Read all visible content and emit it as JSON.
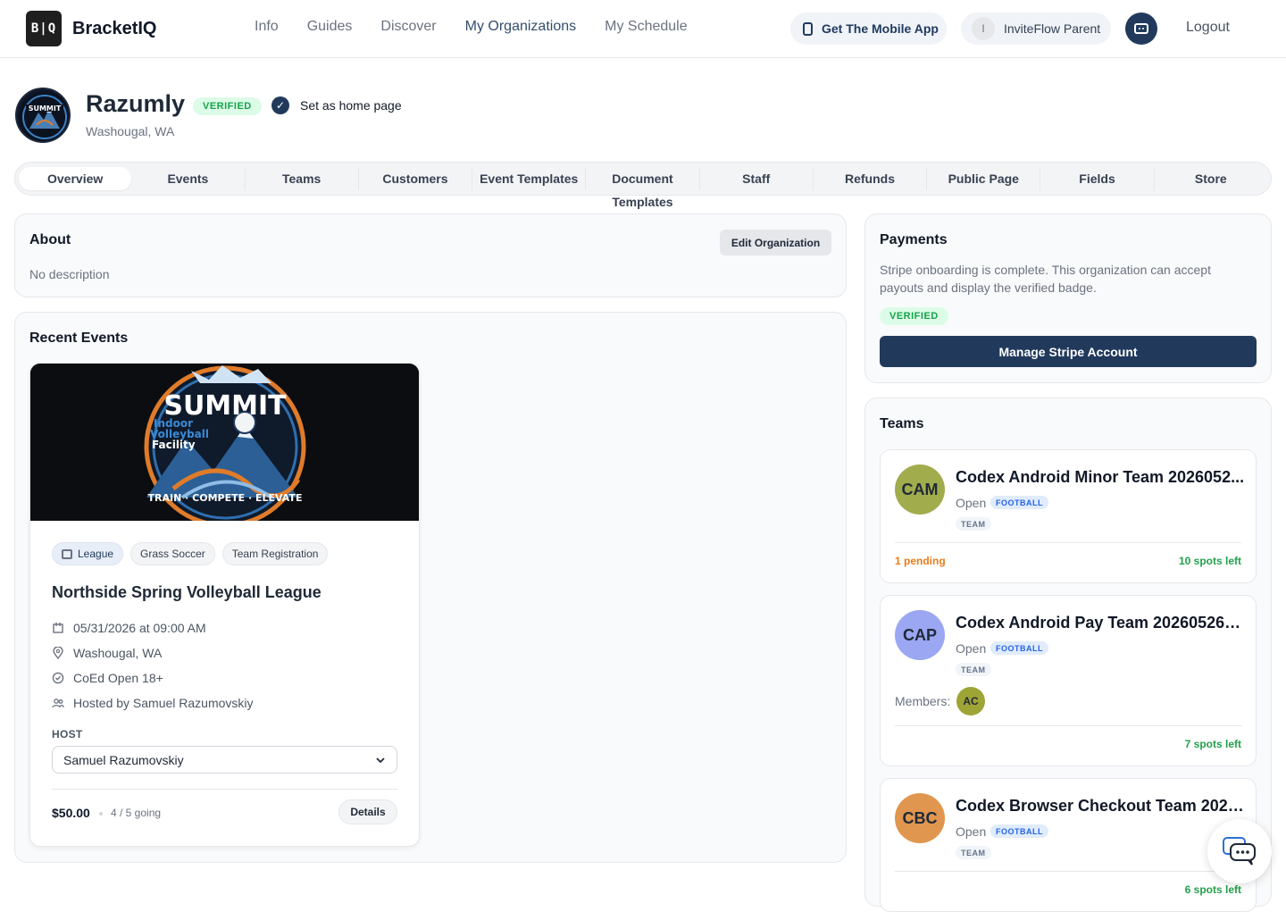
{
  "app": {
    "logo_text": "B|Q",
    "name": "BracketIQ"
  },
  "nav": {
    "links": [
      "Info",
      "Guides",
      "Discover",
      "My Organizations",
      "My Schedule"
    ],
    "mobile_app": "Get The Mobile App",
    "user_initial": "I",
    "user_name": "InviteFlow Parent",
    "logout": "Logout"
  },
  "org": {
    "name": "Razumly",
    "verified": "VERIFIED",
    "home_page_label": "Set as home page",
    "location": "Washougal, WA"
  },
  "tabs": [
    "Overview",
    "Events",
    "Teams",
    "Customers",
    "Event Templates",
    "Document Templates",
    "Staff",
    "Refunds",
    "Public Page",
    "Fields",
    "Store"
  ],
  "about": {
    "title": "About",
    "edit_button": "Edit Organization",
    "description": "No description"
  },
  "recent_events": {
    "title": "Recent Events",
    "event": {
      "hero": {
        "title": "SUMMIT",
        "sub1": "Indoor",
        "sub2": "Volleyball",
        "sub3": "Facility",
        "tagline": "TRAIN · COMPETE · ELEVATE"
      },
      "chips": [
        "League",
        "Grass Soccer",
        "Team Registration"
      ],
      "title": "Northside Spring Volleyball League",
      "datetime": "05/31/2026 at 09:00 AM",
      "location": "Washougal, WA",
      "division": "CoEd Open 18+",
      "hosted_by": "Hosted by Samuel Razumovskiy",
      "host_label": "HOST",
      "host_value": "Samuel Razumovskiy",
      "price": "$50.00",
      "going": "4 / 5 going",
      "details": "Details"
    }
  },
  "payments": {
    "title": "Payments",
    "text": "Stripe onboarding is complete. This organization can accept payouts and display the verified badge.",
    "badge": "VERIFIED",
    "button": "Manage Stripe Account"
  },
  "teams": {
    "title": "Teams",
    "items": [
      {
        "initials": "CAM",
        "color": "#a1ac4d",
        "name": "Codex Android Minor Team 2026052...",
        "status": "Open",
        "sport": "FOOTBALL",
        "type": "TEAM",
        "pending": "1 pending",
        "spots": "10 spots left"
      },
      {
        "initials": "CAP",
        "color": "#9ba7f2",
        "name": "Codex Android Pay Team 202605262...",
        "status": "Open",
        "sport": "FOOTBALL",
        "type": "TEAM",
        "members_label": "Members:",
        "member_initials": "AC",
        "spots": "7 spots left"
      },
      {
        "initials": "CBC",
        "color": "#e0964e",
        "name": "Codex Browser Checkout Team 2026...",
        "status": "Open",
        "sport": "FOOTBALL",
        "type": "TEAM",
        "spots": "6 spots left"
      }
    ]
  },
  "colors": {
    "primary": "#213a5c",
    "verified_bg": "#dcfce7",
    "verified_text": "#16a34a",
    "pending": "#ea7c1a",
    "spots": "#22a04b"
  },
  "icons": {
    "mobile": "phone-icon",
    "assistant": "robot-icon",
    "check": "check-circle-icon",
    "chat": "chat-icon"
  }
}
